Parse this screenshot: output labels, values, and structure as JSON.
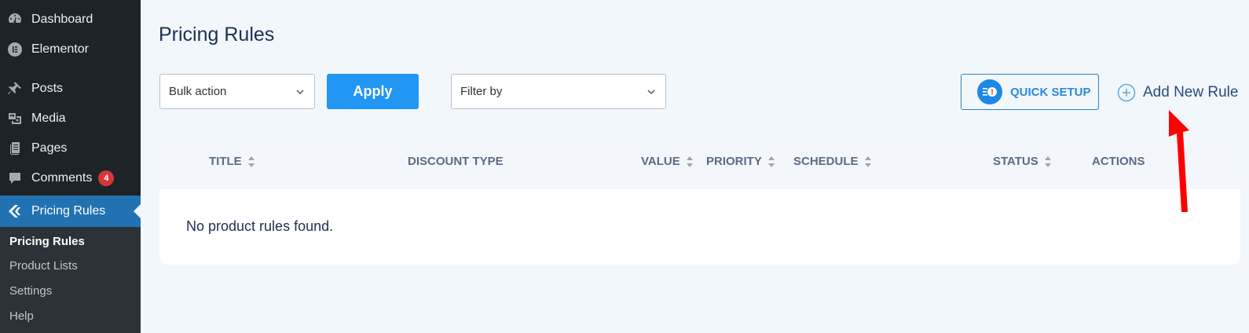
{
  "sidebar": {
    "items": [
      {
        "label": "Dashboard",
        "icon": "dashboard-icon"
      },
      {
        "label": "Elementor",
        "icon": "elementor-icon"
      },
      {
        "label": "Posts",
        "icon": "pin-icon"
      },
      {
        "label": "Media",
        "icon": "media-icon"
      },
      {
        "label": "Pages",
        "icon": "pages-icon"
      },
      {
        "label": "Comments",
        "icon": "comments-icon",
        "badge": "4"
      },
      {
        "label": "Pricing Rules",
        "icon": "pricing-rules-icon",
        "active": true
      }
    ],
    "submenu": [
      {
        "label": "Pricing Rules",
        "current": true
      },
      {
        "label": "Product Lists"
      },
      {
        "label": "Settings"
      },
      {
        "label": "Help"
      }
    ]
  },
  "page": {
    "title": "Pricing Rules"
  },
  "toolbar": {
    "bulk_action": "Bulk action",
    "apply_label": "Apply",
    "filter_by": "Filter by",
    "quick_setup_label": "QUICK SETUP",
    "add_new_rule_label": "Add New Rule"
  },
  "table": {
    "columns": [
      "TITLE",
      "DISCOUNT TYPE",
      "VALUE",
      "PRIORITY",
      "SCHEDULE",
      "STATUS",
      "ACTIONS"
    ],
    "empty_message": "No product rules found."
  },
  "colors": {
    "sidebar_bg": "#1d2327",
    "accent": "#2196f3",
    "active_menu": "#2271b1",
    "badge": "#d63638",
    "annotation_arrow": "#ff0000"
  }
}
